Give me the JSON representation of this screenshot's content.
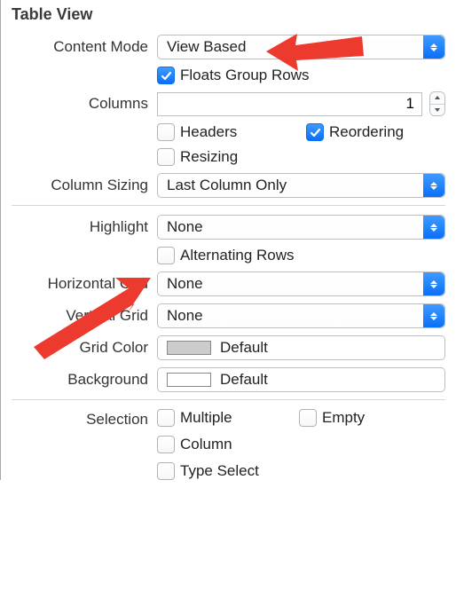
{
  "sectionTitle": "Table View",
  "labels": {
    "contentMode": "Content Mode",
    "columns": "Columns",
    "columnSizing": "Column Sizing",
    "highlight": "Highlight",
    "horizontalGrid": "Horizontal Grid",
    "verticalGrid": "Vertical Grid",
    "gridColor": "Grid Color",
    "background": "Background",
    "selection": "Selection"
  },
  "values": {
    "contentMode": "View Based",
    "columns": "1",
    "columnSizing": "Last Column Only",
    "highlight": "None",
    "horizontalGrid": "None",
    "verticalGrid": "None",
    "gridColor": "Default",
    "background": "Default"
  },
  "colors": {
    "gridColor": "#cccccc",
    "background": "#ffffff"
  },
  "checkboxes": {
    "floatsGroupRows": {
      "label": "Floats Group Rows",
      "checked": true
    },
    "headers": {
      "label": "Headers",
      "checked": false
    },
    "reordering": {
      "label": "Reordering",
      "checked": true
    },
    "resizing": {
      "label": "Resizing",
      "checked": false
    },
    "alternatingRows": {
      "label": "Alternating Rows",
      "checked": false
    },
    "multiple": {
      "label": "Multiple",
      "checked": false
    },
    "empty": {
      "label": "Empty",
      "checked": false
    },
    "column": {
      "label": "Column",
      "checked": false
    },
    "typeSelect": {
      "label": "Type Select",
      "checked": false
    }
  }
}
